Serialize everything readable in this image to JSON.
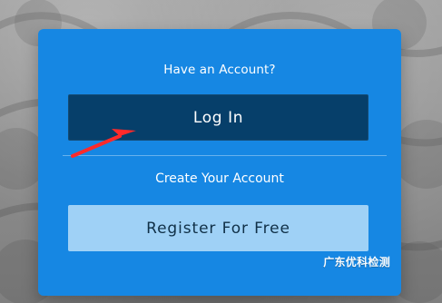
{
  "app": {
    "title": "Have an Account?",
    "login_label": "Log In",
    "create_label": "Create Your Account",
    "register_label": "Register For Free",
    "watermark": "广东优科检测"
  },
  "colors": {
    "card": "#1687e3",
    "login_button": "#063f6a",
    "register_button": "#9fd1f6",
    "arrow": "#ff2a2a"
  },
  "icons": {
    "arrow": "red-arrow-icon"
  }
}
